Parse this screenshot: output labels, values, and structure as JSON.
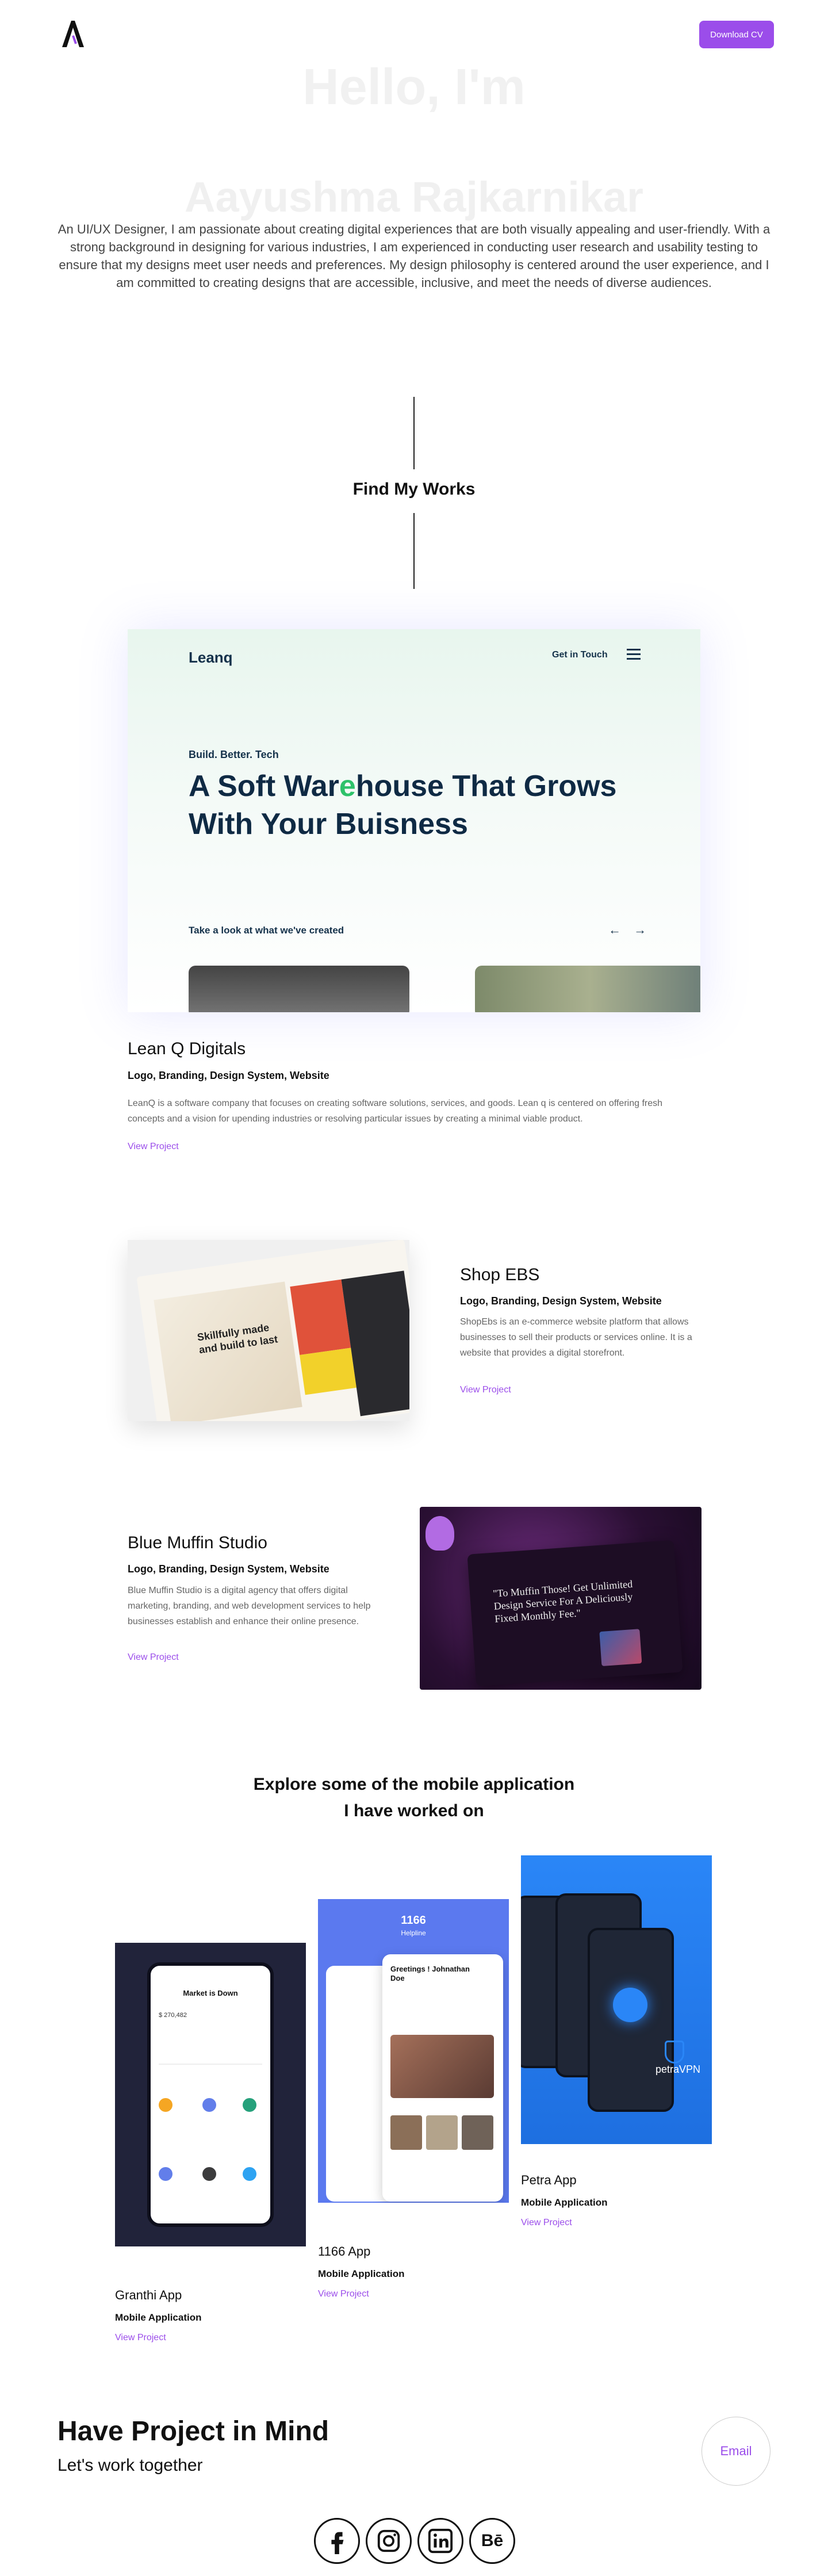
{
  "header": {
    "logo_alt": "A",
    "download_cv": "Download CV"
  },
  "hero": {
    "greeting": "Hello, I'm",
    "name": "Aayushma Rajkarnikar",
    "description": "An UI/UX Designer, I am passionate about creating digital experiences that are both visually appealing and user-friendly. With a strong background in designing for various industries, I am experienced in conducting user research and usability testing to ensure that my designs meet user needs and preferences. My design philosophy is centered around the user experience, and I am committed to creating designs that are accessible, inclusive, and meet the needs of diverse audiences."
  },
  "works": {
    "title": "Find My Works"
  },
  "projects": [
    {
      "title": "Lean Q Digitals",
      "tags": "Logo, Branding, Design System, Website",
      "description": "LeanQ is a software company that focuses on creating software solutions, services, and goods. Lean q is centered on offering fresh concepts and a vision for upending industries or resolving particular issues by creating a minimal viable product.",
      "link": "View Project",
      "preview": {
        "brand": "Leanq",
        "nav_cta": "Get in Touch",
        "kicker": "Build. Better. Tech",
        "headline_part1": "A Soft War",
        "headline_accent": "e",
        "headline_part2": "house That Grows With Your Buisness",
        "look_text": "Take a look at  what we've created",
        "arrows": "← →"
      }
    },
    {
      "title": "Shop EBS",
      "tags": "Logo, Branding, Design System, Website",
      "description": "ShopEbs is an e-commerce website platform that allows businesses to sell their products or services online. It is a website that provides a digital storefront.",
      "link": "View Project",
      "preview": {
        "headline": "Skillfully made and build to last"
      }
    },
    {
      "title": "Blue Muffin Studio",
      "tags": "Logo, Branding, Design System, Website",
      "description": "Blue Muffin Studio is a digital agency that offers digital marketing, branding, and web development services to help businesses establish and enhance their online presence.",
      "link": "View Project",
      "preview": {
        "quote": "\"To Muffin Those! Get Unlimited Design Service For A Deliciously Fixed Monthly Fee.\""
      }
    }
  ],
  "mobile": {
    "title_line1": "Explore some of the mobile application",
    "title_line2": "I have worked on",
    "apps": [
      {
        "name": "Granthi App",
        "type": "Mobile Application",
        "link": "View Project",
        "screen_title": "Market is Down",
        "screen_value": "$ 270,482"
      },
      {
        "name": "1166 App",
        "type": "Mobile Application",
        "link": "View Project",
        "screen_title": "1166",
        "screen_sub": "Helpline",
        "greeting": "Greetings ! Johnathan Doe"
      },
      {
        "name": "Petra App",
        "type": "Mobile Application",
        "link": "View Project",
        "brand": "petraVPN"
      }
    ]
  },
  "footer": {
    "cta_title": "Have Project in Mind",
    "cta_sub": "Let's work together",
    "email": "Email",
    "socials": [
      "facebook-icon",
      "instagram-icon",
      "linkedin-icon",
      "behance-icon"
    ]
  },
  "colors": {
    "accent": "#9b4dea",
    "leanq_green": "#2ec26a",
    "petra_blue": "#2a86f7",
    "app1166_blue": "#5b79ef"
  }
}
